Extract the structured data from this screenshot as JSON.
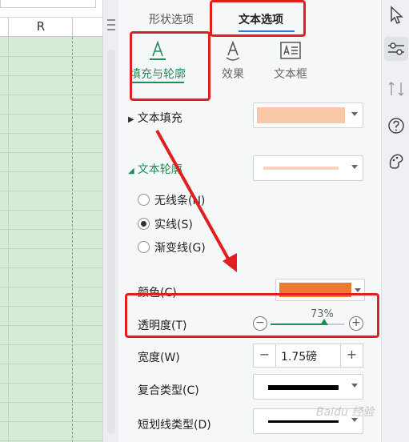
{
  "sheet": {
    "column_letter": "R"
  },
  "panel": {
    "tabs": [
      {
        "label": "形状选项",
        "active": false
      },
      {
        "label": "文本选项",
        "active": true
      }
    ],
    "subtabs": [
      {
        "label": "填充与轮廓",
        "icon": "text-fill-icon",
        "active": true
      },
      {
        "label": "效果",
        "icon": "text-effect-icon",
        "active": false
      },
      {
        "label": "文本框",
        "icon": "textbox-icon",
        "active": false
      }
    ],
    "text_fill": {
      "label": "文本填充",
      "color": "#f8c7a8"
    },
    "text_outline": {
      "label": "文本轮廓",
      "preview_color": "#f8d3bc",
      "options": [
        {
          "label": "无线条(N)",
          "selected": false
        },
        {
          "label": "实线(S)",
          "selected": true
        },
        {
          "label": "渐变线(G)",
          "selected": false
        }
      ],
      "color_label": "颜色(C)",
      "color": "#ec7b2d",
      "transparency_label": "透明度(T)",
      "transparency_value": "73%",
      "transparency_percent": 73,
      "width_label": "宽度(W)",
      "width_value": "1.75磅",
      "compound_label": "复合类型(C)",
      "dash_label": "短划线类型(D)"
    }
  },
  "toolbar": [
    "cursor-icon",
    "properties-icon",
    "move-icon",
    "help-icon",
    "style-icon"
  ],
  "annotation_color": "#e02020",
  "watermark": "Baidu 经验"
}
